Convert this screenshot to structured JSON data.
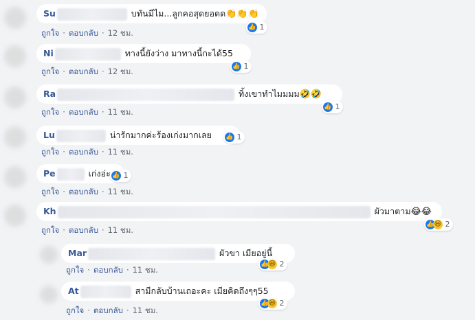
{
  "actions": {
    "like": "ถูกใจ",
    "reply": "ตอบกลับ",
    "dot": "·"
  },
  "comments": [
    {
      "name": "Su",
      "text": "บทันมีไม...ลูกคอสุดยอดด",
      "emoji": "👏👏👏",
      "reactions": {
        "like": true,
        "haha": false,
        "count": "1"
      },
      "time": "12 ชม."
    },
    {
      "name": "Ni",
      "text": "ทางนี้ยังว่าง มาทางนี้กะได้55",
      "emoji": "",
      "reactions": {
        "like": true,
        "haha": false,
        "count": "1"
      },
      "time": "12 ชม."
    },
    {
      "name": "Ra",
      "text": "ทิ้งเขาทำไมมมม",
      "emoji": "🤣🤣",
      "reactions": {
        "like": true,
        "haha": false,
        "count": "1"
      },
      "time": "11 ชม."
    },
    {
      "name": "Lu",
      "text": "น่ารักมากค่ะร้องเก่งมากเลย",
      "emoji": "",
      "reactions": {
        "like": true,
        "haha": false,
        "count": "1"
      },
      "time": "11 ชม."
    },
    {
      "name": "Pe",
      "text": "เก่งอ่ะ",
      "emoji": "",
      "reactions": {
        "like": true,
        "haha": false,
        "count": "1"
      },
      "time": "11 ชม."
    },
    {
      "name": "Kh",
      "text": "ผัวมาตาม",
      "emoji": "😂😂",
      "reactions": {
        "like": true,
        "haha": true,
        "count": "2"
      },
      "time": "11 ชม."
    },
    {
      "name": "Mar",
      "text": "ผัวขา เมียอยู่นี้",
      "emoji": "",
      "reactions": {
        "like": true,
        "haha": true,
        "count": "2"
      },
      "time": "11 ชม."
    },
    {
      "name": "At",
      "text": "สามีกลับบ้านเถอะคะ เมียคิดถึงๆๆ55",
      "emoji": "",
      "reactions": {
        "like": true,
        "haha": true,
        "count": "2"
      },
      "time": "11 ชม."
    }
  ],
  "colors": {
    "background": "#f2f3f5",
    "name": "#385898",
    "like": "#1877f2"
  }
}
